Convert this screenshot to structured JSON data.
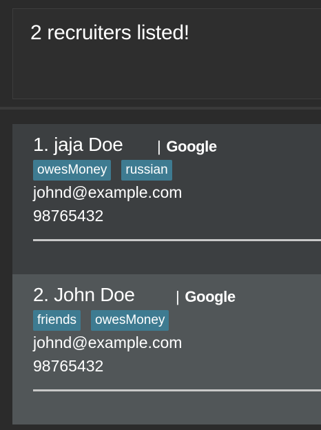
{
  "result": {
    "message": "2 recruiters listed!"
  },
  "recruiters": [
    {
      "name": "1. jaja Doe",
      "company": "Google",
      "separator": "|",
      "tags": [
        "owesMoney",
        "russian"
      ],
      "email": "johnd@example.com",
      "phone": "98765432"
    },
    {
      "name": "2. John Doe",
      "company": "Google",
      "separator": "|",
      "tags": [
        "friends",
        "owesMoney"
      ],
      "email": "johnd@example.com",
      "phone": "98765432"
    }
  ],
  "colors": {
    "background": "#2b2b2b",
    "card_default": "#3c3f41",
    "card_selected": "#515658",
    "tag": "#3e7b91",
    "text": "#ffffff"
  }
}
